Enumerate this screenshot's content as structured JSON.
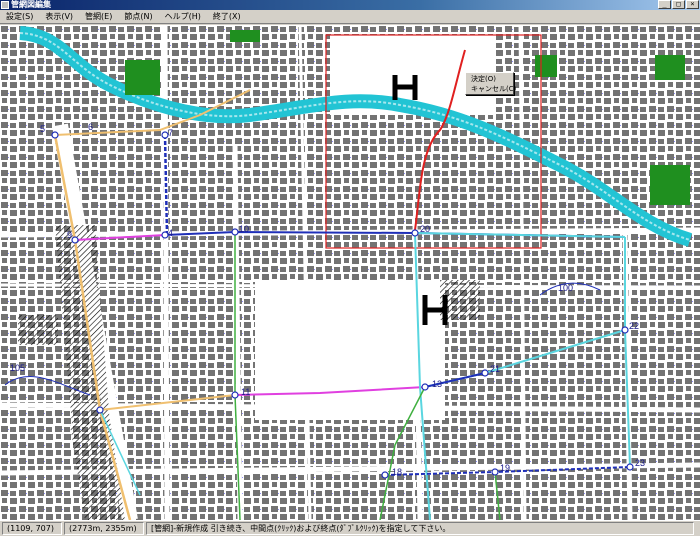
{
  "window": {
    "title": "管網図編集",
    "minimize": "_",
    "maximize": "□",
    "close": "×"
  },
  "menu": [
    "設定(S)",
    "表示(V)",
    "管網(E)",
    "節点(N)",
    "ヘルプ(H)",
    "終了(X)"
  ],
  "context_menu": {
    "ok": "決定(O)",
    "cancel": "キャンセル(C)"
  },
  "map": {
    "contour_label_1": "105",
    "contour_label_2": "100",
    "nodes": [
      {
        "label": "5"
      },
      {
        "label": "6"
      },
      {
        "label": "9"
      },
      {
        "label": "7"
      },
      {
        "label": "10"
      },
      {
        "label": "11"
      },
      {
        "label": "20"
      },
      {
        "label": "21"
      },
      {
        "label": "22"
      },
      {
        "label": "23"
      },
      {
        "label": "18"
      },
      {
        "label": "19"
      },
      {
        "label": "4"
      },
      {
        "label": "13"
      }
    ],
    "colors": {
      "river": "#22c4d4",
      "pipe_blue": "#1f2fb8",
      "pipe_cyan": "#5ad6e0",
      "pipe_orange": "#f0c070",
      "pipe_magenta": "#e040e0",
      "pipe_green": "#40b040",
      "selection": "#e02020"
    }
  },
  "status": {
    "cursor": "(1109, 707)",
    "coords": "(2773m, 2355m)",
    "message": "[管網]-新規作成 引き続き、中間点(ｸﾘｯｸ)および終点(ﾀﾞﾌﾞﾙｸﾘｯｸ)を指定して下さい。"
  }
}
